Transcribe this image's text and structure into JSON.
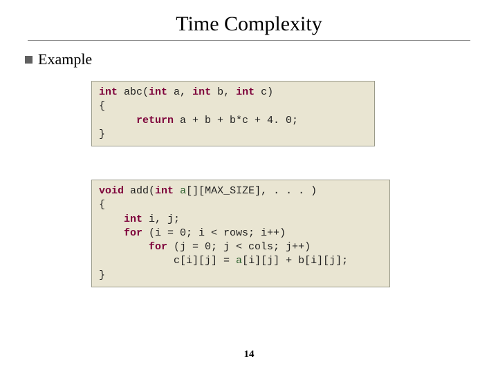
{
  "title": "Time Complexity",
  "bullet": "Example",
  "code1": {
    "l1a": "int",
    "l1b": " abc(",
    "l1c": "int",
    "l1d": " a, ",
    "l1e": "int",
    "l1f": " b, ",
    "l1g": "int",
    "l1h": " c)",
    "l2": "{",
    "l3a": "      ",
    "l3b": "return",
    "l3c": " a + b + b*c + 4. 0;",
    "l4": "}"
  },
  "code2": {
    "l1a": "void",
    "l1b": " add(",
    "l1c": "int",
    "l1d": " ",
    "l1e": "a",
    "l1f": "[][MAX_SIZE], . . . )",
    "l2": "{",
    "l3a": "    ",
    "l3b": "int",
    "l3c": " i, j;",
    "l4a": "    ",
    "l4b": "for",
    "l4c": " (i = 0; i < rows; i++)",
    "l5a": "        ",
    "l5b": "for",
    "l5c": " (j = 0; j < cols; j++)",
    "l6a": "            c[i][j] = ",
    "l6b": "a",
    "l6c": "[i][j] + b[i][j];",
    "l7": "}"
  },
  "pagenum": "14"
}
